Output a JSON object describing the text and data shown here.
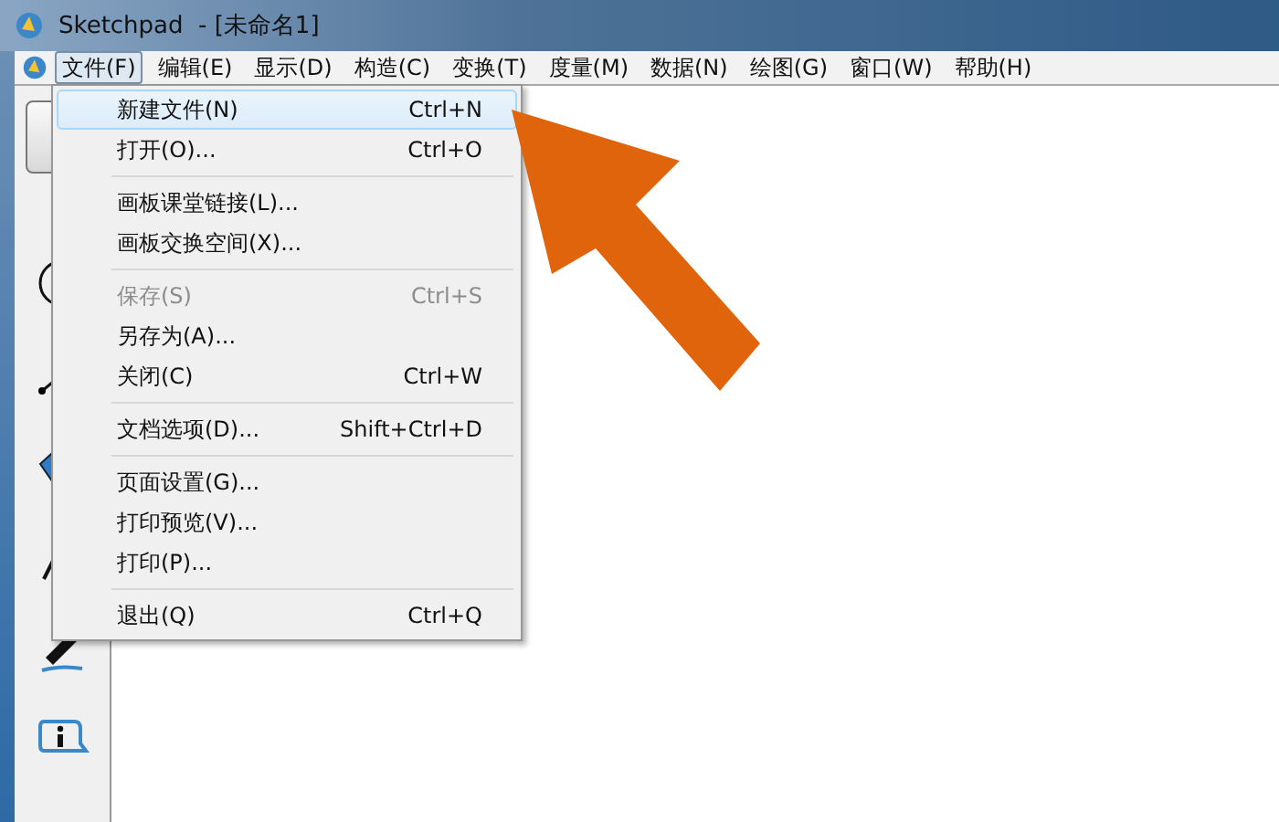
{
  "window": {
    "title": "Sketchpad  - [未命名1]"
  },
  "menu_bar": [
    {
      "label": "文件(F)",
      "selected": true
    },
    {
      "label": "编辑(E)",
      "selected": false
    },
    {
      "label": "显示(D)",
      "selected": false
    },
    {
      "label": "构造(C)",
      "selected": false
    },
    {
      "label": "变换(T)",
      "selected": false
    },
    {
      "label": "度量(M)",
      "selected": false
    },
    {
      "label": "数据(N)",
      "selected": false
    },
    {
      "label": "绘图(G)",
      "selected": false
    },
    {
      "label": "窗口(W)",
      "selected": false
    },
    {
      "label": "帮助(H)",
      "selected": false
    }
  ],
  "file_menu": [
    {
      "kind": "item",
      "label": "新建文件(N)",
      "shortcut": "Ctrl+N",
      "selected": true,
      "disabled": false
    },
    {
      "kind": "item",
      "label": "打开(O)...",
      "shortcut": "Ctrl+O",
      "selected": false,
      "disabled": false
    },
    {
      "kind": "separator"
    },
    {
      "kind": "item",
      "label": "画板课堂链接(L)...",
      "selected": false,
      "disabled": false
    },
    {
      "kind": "item",
      "label": "画板交换空间(X)...",
      "selected": false,
      "disabled": false
    },
    {
      "kind": "separator"
    },
    {
      "kind": "item",
      "label": "保存(S)",
      "shortcut": "Ctrl+S",
      "selected": false,
      "disabled": true
    },
    {
      "kind": "item",
      "label": "另存为(A)...",
      "selected": false,
      "disabled": false
    },
    {
      "kind": "item",
      "label": "关闭(C)",
      "shortcut": "Ctrl+W",
      "selected": false,
      "disabled": false
    },
    {
      "kind": "separator"
    },
    {
      "kind": "item",
      "label": "文档选项(D)...",
      "shortcut": "Shift+Ctrl+D",
      "selected": false,
      "disabled": false
    },
    {
      "kind": "separator"
    },
    {
      "kind": "item",
      "label": "页面设置(G)...",
      "selected": false,
      "disabled": false
    },
    {
      "kind": "item",
      "label": "打印预览(V)...",
      "selected": false,
      "disabled": false
    },
    {
      "kind": "item",
      "label": "打印(P)...",
      "selected": false,
      "disabled": false
    },
    {
      "kind": "separator"
    },
    {
      "kind": "item",
      "label": "退出(Q)",
      "shortcut": "Ctrl+Q",
      "selected": false,
      "disabled": false
    }
  ]
}
